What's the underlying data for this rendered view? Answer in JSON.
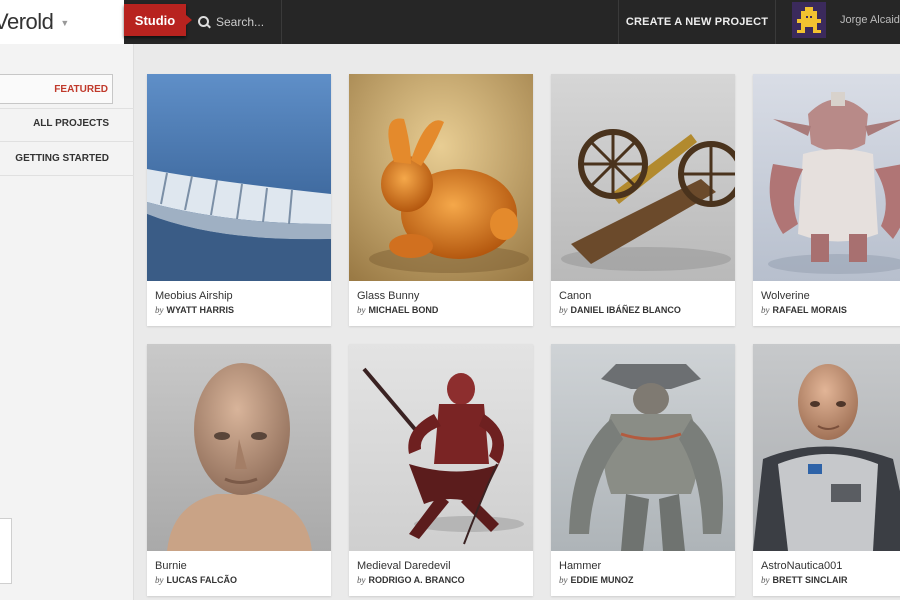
{
  "brand": {
    "logo_text": "Verold",
    "studio_label": "Studio"
  },
  "header": {
    "search_placeholder": "Search...",
    "create_label": "CREATE A NEW PROJECT",
    "user_name": "Jorge Alcaide"
  },
  "sidebar": {
    "items": [
      {
        "label": "FEATURED",
        "active": true
      },
      {
        "label": "ALL PROJECTS",
        "active": false
      },
      {
        "label": "GETTING STARTED",
        "active": false
      }
    ]
  },
  "byline_prefix": "by",
  "projects": [
    {
      "title": "Meobius Airship",
      "author": "WYATT HARRIS"
    },
    {
      "title": "Glass Bunny",
      "author": "MICHAEL BOND"
    },
    {
      "title": "Canon",
      "author": "DANIEL IBÁÑEZ BLANCO"
    },
    {
      "title": "Wolverine",
      "author": "RAFAEL MORAIS"
    },
    {
      "title": "Burnie",
      "author": "LUCAS FALCÃO"
    },
    {
      "title": "Medieval Daredevil",
      "author": "RODRIGO A. BRANCO"
    },
    {
      "title": "Hammer",
      "author": "EDDIE MUNOZ"
    },
    {
      "title": "AstroNautica001",
      "author": "BRETT SINCLAIR"
    }
  ],
  "colors": {
    "accent": "#b8231f",
    "topbar": "#262626",
    "active_nav": "#c0392b"
  },
  "icons": {
    "search": "search-icon",
    "caret": "caret-down-icon"
  }
}
